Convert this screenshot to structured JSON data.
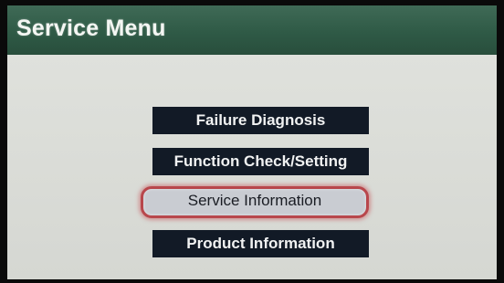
{
  "header": {
    "title": "Service Menu"
  },
  "menu": {
    "items": [
      {
        "label": "Failure Diagnosis",
        "selected": false
      },
      {
        "label": "Function Check/Setting",
        "selected": false
      },
      {
        "label": "Service Information",
        "selected": true
      },
      {
        "label": "Product Information",
        "selected": false
      }
    ]
  },
  "colors": {
    "title_bar": "#2f5a46",
    "button_bg": "#121a26",
    "selected_bg": "#c9ccd2",
    "selected_outline": "#b8474c",
    "screen_bg": "#d8dad6"
  }
}
